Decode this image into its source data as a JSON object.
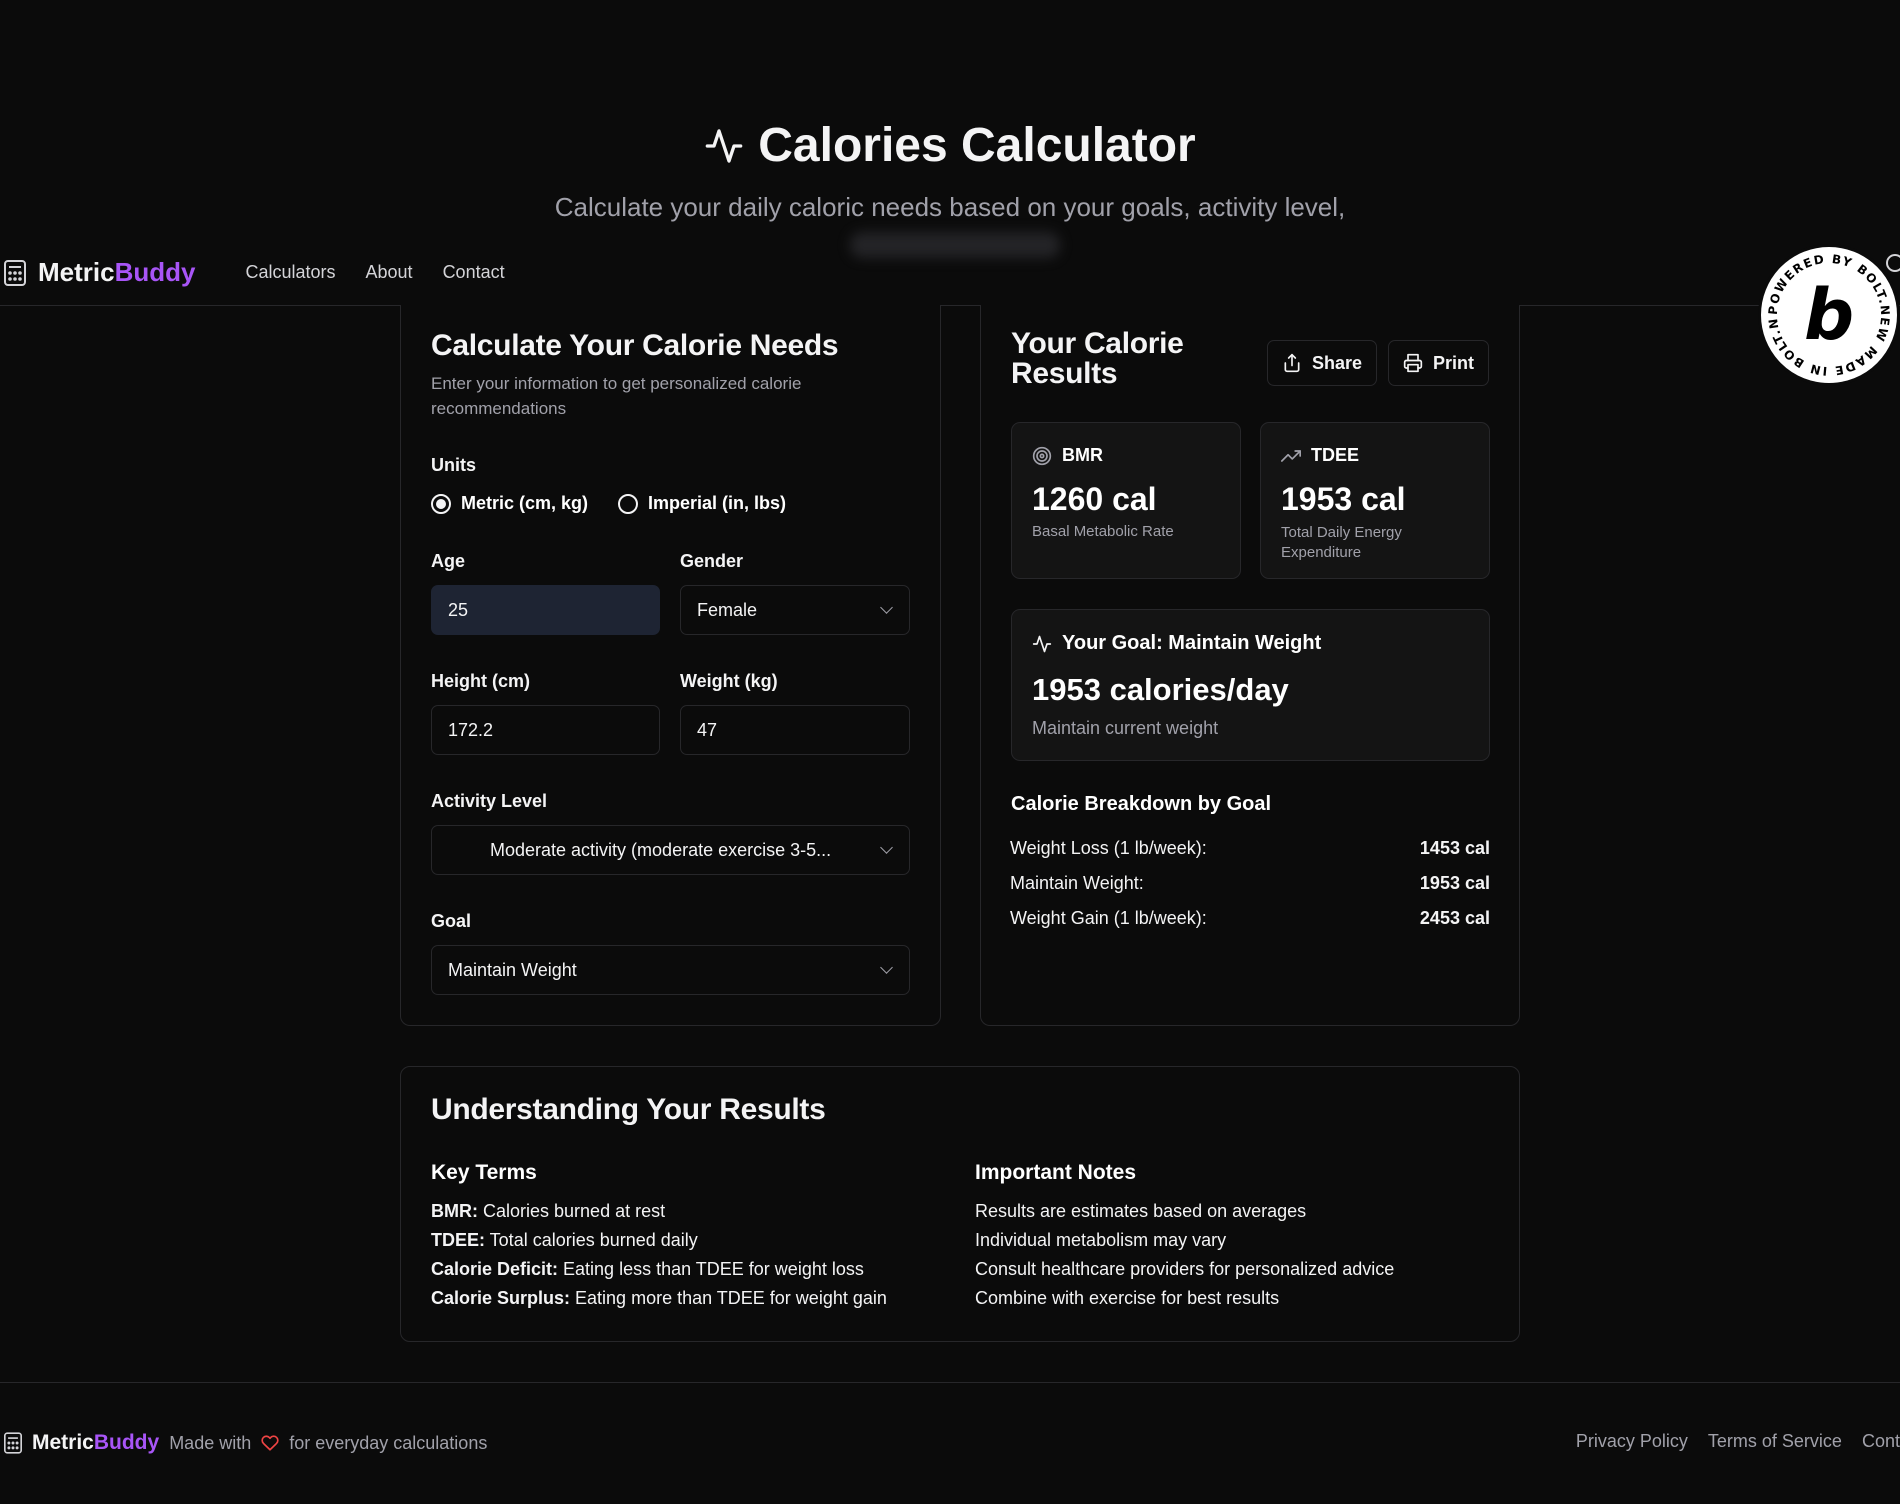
{
  "hero": {
    "title": "Calories Calculator",
    "subtitle": "Calculate your daily caloric needs based on your goals, activity level,"
  },
  "header": {
    "brand_part1": "Metric",
    "brand_part2": "Buddy",
    "nav": [
      "Calculators",
      "About",
      "Contact"
    ],
    "badge_text": "POWERED BY BOLT.NEW MADE IN BOLT.NEW",
    "badge_letter": "b"
  },
  "form": {
    "title": "Calculate Your Calorie Needs",
    "description": "Enter your information to get personalized calorie recommendations",
    "units_label": "Units",
    "unit_metric": "Metric (cm, kg)",
    "unit_imperial": "Imperial (in, lbs)",
    "selected_unit": "metric",
    "age_label": "Age",
    "age_value": "25",
    "gender_label": "Gender",
    "gender_value": "Female",
    "height_label": "Height (cm)",
    "height_value": "172.2",
    "weight_label": "Weight (kg)",
    "weight_value": "47",
    "activity_label": "Activity Level",
    "activity_value": "Moderate activity (moderate exercise 3-5...",
    "goal_label": "Goal",
    "goal_value": "Maintain Weight"
  },
  "results": {
    "title_line1": "Your Calorie",
    "title_line2": "Results",
    "share_label": "Share",
    "print_label": "Print",
    "bmr": {
      "label": "BMR",
      "value": "1260 cal",
      "desc": "Basal Metabolic Rate"
    },
    "tdee": {
      "label": "TDEE",
      "value": "1953 cal",
      "desc_line1": "Total Daily Energy",
      "desc_line2": "Expenditure"
    },
    "goal": {
      "label": "Your Goal: Maintain Weight",
      "value": "1953 calories/day",
      "desc": "Maintain current weight"
    },
    "breakdown_title": "Calorie Breakdown by Goal",
    "breakdown": [
      {
        "label": "Weight Loss (1 lb/week):",
        "value": "1453 cal"
      },
      {
        "label": "Maintain Weight:",
        "value": "1953 cal"
      },
      {
        "label": "Weight Gain (1 lb/week):",
        "value": "2453 cal"
      }
    ]
  },
  "understanding": {
    "title": "Understanding Your Results",
    "key_terms_title": "Key Terms",
    "key_terms": [
      {
        "term": "BMR:",
        "def": " Calories burned at rest"
      },
      {
        "term": "TDEE:",
        "def": " Total calories burned daily"
      },
      {
        "term": "Calorie Deficit:",
        "def": " Eating less than TDEE for weight loss"
      },
      {
        "term": "Calorie Surplus:",
        "def": " Eating more than TDEE for weight gain"
      }
    ],
    "notes_title": "Important Notes",
    "notes": [
      "Results are estimates based on averages",
      "Individual metabolism may vary",
      "Consult healthcare providers for personalized advice",
      "Combine with exercise for best results"
    ]
  },
  "footer": {
    "brand_part1": "Metric",
    "brand_part2": "Buddy",
    "made_with": "Made with",
    "tagline": "for everyday calculations",
    "links": [
      "Privacy Policy",
      "Terms of Service",
      "Conta"
    ]
  },
  "colors": {
    "background": "#0b0b0b",
    "accent": "#a855f7",
    "heart": "#ef4444",
    "active_input": "#1e2433",
    "border": "#27272a"
  }
}
